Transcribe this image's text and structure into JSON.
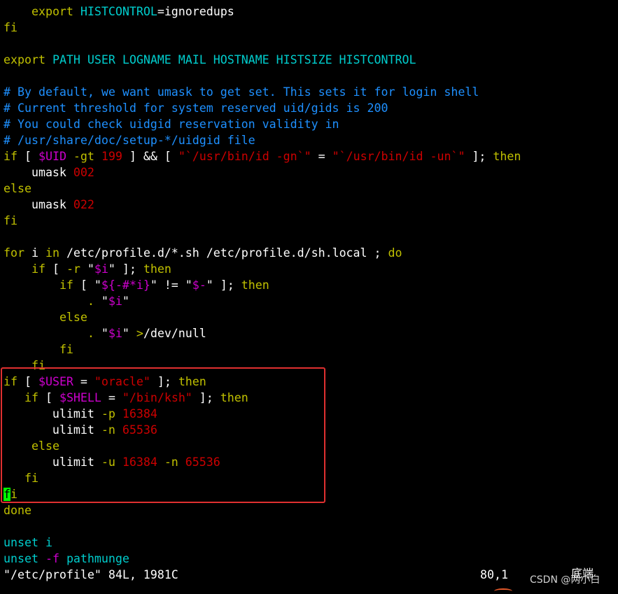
{
  "lines": [
    [
      {
        "t": "    "
      },
      {
        "t": "export",
        "c": "k"
      },
      {
        "t": " "
      },
      {
        "t": "HISTCONTROL",
        "c": "c"
      },
      {
        "t": "=ignoredups"
      }
    ],
    [
      {
        "t": "fi",
        "c": "k"
      }
    ],
    [],
    [
      {
        "t": "export",
        "c": "k"
      },
      {
        "t": " "
      },
      {
        "t": "PATH USER LOGNAME MAIL HOSTNAME HISTSIZE HISTCONTROL",
        "c": "c"
      }
    ],
    [],
    [
      {
        "t": "# By default, we want umask to get set. This sets it for login shell",
        "c": "cm"
      }
    ],
    [
      {
        "t": "# Current threshold for system reserved uid/gids is 200",
        "c": "cm"
      }
    ],
    [
      {
        "t": "# You could check uidgid reservation validity in",
        "c": "cm"
      }
    ],
    [
      {
        "t": "# /usr/share/doc/setup-*/uidgid file",
        "c": "cm"
      }
    ],
    [
      {
        "t": "if",
        "c": "k"
      },
      {
        "t": " [ "
      },
      {
        "t": "$UID",
        "c": "v"
      },
      {
        "t": " -gt ",
        "c": "k"
      },
      {
        "t": "199",
        "c": "n"
      },
      {
        "t": " ] && [ "
      },
      {
        "t": "\"`/usr/bin/id -gn`\"",
        "c": "s"
      },
      {
        "t": " = "
      },
      {
        "t": "\"`/usr/bin/id -un`\"",
        "c": "s"
      },
      {
        "t": " ]; "
      },
      {
        "t": "then",
        "c": "k"
      }
    ],
    [
      {
        "t": "    umask "
      },
      {
        "t": "002",
        "c": "n"
      }
    ],
    [
      {
        "t": "else",
        "c": "k"
      }
    ],
    [
      {
        "t": "    umask "
      },
      {
        "t": "022",
        "c": "n"
      }
    ],
    [
      {
        "t": "fi",
        "c": "k"
      }
    ],
    [],
    [
      {
        "t": "for",
        "c": "k"
      },
      {
        "t": " i "
      },
      {
        "t": "in",
        "c": "k"
      },
      {
        "t": " /etc/profile.d/*.sh /etc/profile.d/sh.local ; "
      },
      {
        "t": "do",
        "c": "k"
      }
    ],
    [
      {
        "t": "    "
      },
      {
        "t": "if",
        "c": "k"
      },
      {
        "t": " [ "
      },
      {
        "t": "-r",
        "c": "k"
      },
      {
        "t": " \""
      },
      {
        "t": "$i",
        "c": "v"
      },
      {
        "t": "\" ]; "
      },
      {
        "t": "then",
        "c": "k"
      }
    ],
    [
      {
        "t": "        "
      },
      {
        "t": "if",
        "c": "k"
      },
      {
        "t": " [ \""
      },
      {
        "t": "${-#*i}",
        "c": "v"
      },
      {
        "t": "\" != \""
      },
      {
        "t": "$-",
        "c": "v"
      },
      {
        "t": "\" ]; "
      },
      {
        "t": "then",
        "c": "k"
      }
    ],
    [
      {
        "t": "            "
      },
      {
        "t": ".",
        "c": "k"
      },
      {
        "t": " \""
      },
      {
        "t": "$i",
        "c": "v"
      },
      {
        "t": "\""
      }
    ],
    [
      {
        "t": "        "
      },
      {
        "t": "else",
        "c": "k"
      }
    ],
    [
      {
        "t": "            "
      },
      {
        "t": ".",
        "c": "k"
      },
      {
        "t": " \""
      },
      {
        "t": "$i",
        "c": "v"
      },
      {
        "t": "\" "
      },
      {
        "t": ">",
        "c": "k"
      },
      {
        "t": "/dev/null"
      }
    ],
    [
      {
        "t": "        "
      },
      {
        "t": "fi",
        "c": "k"
      }
    ],
    [
      {
        "t": "    "
      },
      {
        "t": "fi",
        "c": "k"
      }
    ],
    [
      {
        "t": "if",
        "c": "k"
      },
      {
        "t": " [ "
      },
      {
        "t": "$USER",
        "c": "v"
      },
      {
        "t": " = "
      },
      {
        "t": "\"oracle\"",
        "c": "s"
      },
      {
        "t": " ]; "
      },
      {
        "t": "then",
        "c": "k"
      }
    ],
    [
      {
        "t": "   "
      },
      {
        "t": "if",
        "c": "k"
      },
      {
        "t": " [ "
      },
      {
        "t": "$SHELL",
        "c": "v"
      },
      {
        "t": " = "
      },
      {
        "t": "\"/bin/ksh\"",
        "c": "s"
      },
      {
        "t": " ]; "
      },
      {
        "t": "then",
        "c": "k"
      }
    ],
    [
      {
        "t": "       ulimit "
      },
      {
        "t": "-p",
        "c": "k"
      },
      {
        "t": " "
      },
      {
        "t": "16384",
        "c": "n"
      }
    ],
    [
      {
        "t": "       ulimit "
      },
      {
        "t": "-n",
        "c": "k"
      },
      {
        "t": " "
      },
      {
        "t": "65536",
        "c": "n"
      }
    ],
    [
      {
        "t": "    "
      },
      {
        "t": "else",
        "c": "k"
      }
    ],
    [
      {
        "t": "       ulimit "
      },
      {
        "t": "-u",
        "c": "k"
      },
      {
        "t": " "
      },
      {
        "t": "16384",
        "c": "n"
      },
      {
        "t": " "
      },
      {
        "t": "-n",
        "c": "k"
      },
      {
        "t": " "
      },
      {
        "t": "65536",
        "c": "n"
      }
    ],
    [
      {
        "t": "   "
      },
      {
        "t": "fi",
        "c": "k"
      }
    ],
    [
      {
        "t": "f",
        "c": "cursor"
      },
      {
        "t": "i",
        "c": "k"
      }
    ],
    [
      {
        "t": "done",
        "c": "k"
      }
    ],
    [],
    [
      {
        "t": "unset",
        "c": "c"
      },
      {
        "t": " "
      },
      {
        "t": "i",
        "c": "c"
      }
    ],
    [
      {
        "t": "unset",
        "c": "c"
      },
      {
        "t": " "
      },
      {
        "t": "-f",
        "c": "v"
      },
      {
        "t": " "
      },
      {
        "t": "pathmunge",
        "c": "c"
      }
    ]
  ],
  "status": {
    "file_info": "\"/etc/profile\" 84L, 1981C",
    "cursor_position": "80,1",
    "scroll_position": "底端"
  },
  "watermark": "CSDN @两小白"
}
